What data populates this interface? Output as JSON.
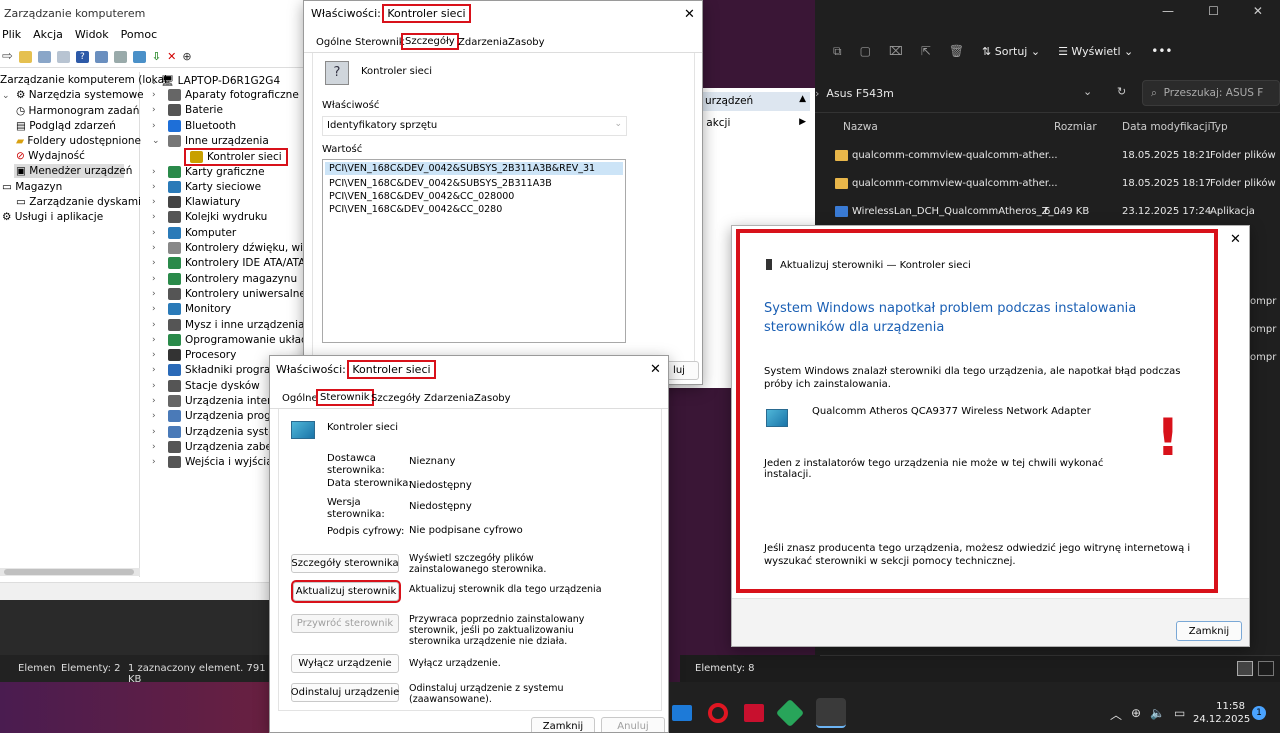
{
  "wallpaper": "#3a1636",
  "cm": {
    "title": "Zarządzanie komputerem",
    "menu": [
      "Plik",
      "Akcja",
      "Widok",
      "Pomoc"
    ],
    "left_tree": [
      "Zarządzanie komputerem (lokal",
      "Narzędzia systemowe",
      "Harmonogram zadań",
      "Podgląd zdarzeń",
      "Foldery udostępnione",
      "Wydajność",
      "Menedżer urządzeń",
      "Magazyn",
      "Zarządzanie dyskami",
      "Usługi i aplikacje"
    ],
    "root": "LAPTOP-D6R1G2G4",
    "devices": [
      "Aparaty fotograficzne",
      "Baterie",
      "Bluetooth",
      "Inne urządzenia",
      "Kontroler sieci",
      "Karty graficzne",
      "Karty sieciowe",
      "Klawiatury",
      "Kolejki wydruku",
      "Komputer",
      "Kontrolery dźwięku, wide",
      "Kontrolery IDE ATA/ATAPI",
      "Kontrolery magazynu",
      "Kontrolery uniwersalnej",
      "Monitory",
      "Mysz i inne urządzenia w",
      "Oprogramowanie układo",
      "Procesory",
      "Składniki progra",
      "Stacje dysków",
      "Urządzenia intert",
      "Urządzenia prog",
      "Urządzenia syste",
      "Urządzenia zabez",
      "Wejścia i wyjścia"
    ],
    "actions": [
      "urządzeń",
      "j akcji"
    ],
    "status": [
      "Elemen",
      "Elementy: 2",
      "1 zaznaczony element. 791 KB"
    ]
  },
  "p1": {
    "title_prefix": "Właściwości:",
    "title_name": "Kontroler sieci",
    "tabs": [
      "Ogólne",
      "Sterownik",
      "Szczegóły",
      "Zdarzenia",
      "Zasoby"
    ],
    "device": "Kontroler sieci",
    "prop_label": "Właściwość",
    "prop_value": "Identyfikatory sprzętu",
    "val_label": "Wartość",
    "values": [
      "PCI\\VEN_168C&DEV_0042&SUBSYS_2B311A3B&REV_31",
      "PCI\\VEN_168C&DEV_0042&SUBSYS_2B311A3B",
      "PCI\\VEN_168C&DEV_0042&CC_028000",
      "PCI\\VEN_168C&DEV_0042&CC_0280"
    ],
    "cancel_partial": "luj"
  },
  "p2": {
    "title_prefix": "Właściwości:",
    "title_name": "Kontroler sieci",
    "tabs": [
      "Ogólne",
      "Sterownik",
      "Szczegóły",
      "Zdarzenia",
      "Zasoby"
    ],
    "device": "Kontroler sieci",
    "fields": [
      {
        "label": "Dostawca sterownika:",
        "value": "Nieznany"
      },
      {
        "label": "Data sterownika:",
        "value": "Niedostępny"
      },
      {
        "label": "Wersja sterownika:",
        "value": "Niedostępny"
      },
      {
        "label": "Podpis cyfrowy:",
        "value": "Nie podpisane cyfrowo"
      }
    ],
    "buttons": [
      {
        "label": "Szczegóły sterownika",
        "desc": "Wyświetl szczegóły plików zainstalowanego sterownika."
      },
      {
        "label": "Aktualizuj sterownik",
        "desc": "Aktualizuj sterownik dla tego urządzenia"
      },
      {
        "label": "Przywróć sterownik",
        "desc": "Przywraca poprzednio zainstalowany sterownik, jeśli po zaktualizowaniu sterownika urządzenie nie działa."
      },
      {
        "label": "Wyłącz urządzenie",
        "desc": "Wyłącz urządzenie."
      },
      {
        "label": "Odinstaluj urządzenie",
        "desc": "Odinstaluj urządzenie z systemu (zaawansowane)."
      }
    ],
    "ok": "Zamknij",
    "cancel": "Anuluj"
  },
  "ex": {
    "sort": "Sortuj",
    "view": "Wyświetl",
    "breadcrumb": "Asus F543m",
    "search": "Przeszukaj: ASUS F",
    "cols": [
      "Nazwa",
      "Rozmiar",
      "Data modyfikacji",
      "Typ"
    ],
    "files": [
      {
        "name": "qualcomm-commview-qualcomm-ather...",
        "size": "",
        "date": "18.05.2025 18:21",
        "type": "Folder plików"
      },
      {
        "name": "qualcomm-commview-qualcomm-ather...",
        "size": "",
        "date": "18.05.2025 18:17",
        "type": "Folder plików"
      },
      {
        "name": "WirelessLan_DCH_QualcommAtheros_Z_...",
        "size": "6 049 KB",
        "date": "23.12.2025 17:24",
        "type": "Aplikacja"
      }
    ],
    "side_partial": [
      "ompr",
      "ompr",
      "ompr"
    ],
    "status": "Elementy: 8"
  },
  "wiz": {
    "title": "Aktualizuj sterowniki — Kontroler sieci",
    "heading": "System Windows napotkał problem podczas instalowania sterowników dla urządzenia",
    "p1": "System Windows znalazł sterowniki dla tego urządzenia, ale napotkał błąd podczas próby ich zainstalowania.",
    "device": "Qualcomm Atheros QCA9377 Wireless Network Adapter",
    "p2": "Jeden z instalatorów tego urządzenia nie może w tej chwili wykonać instalacji.",
    "p3": "Jeśli znasz producenta tego urządzenia, możesz odwiedzić jego witrynę internetową i wyszukać sterowniki w sekcji pomocy technicznej.",
    "close": "Zamknij",
    "accent": "#1a5fb4",
    "alert": "#d8111a"
  },
  "taskbar": {
    "time": "11:58",
    "date": "24.12.2025",
    "badge": "1"
  }
}
